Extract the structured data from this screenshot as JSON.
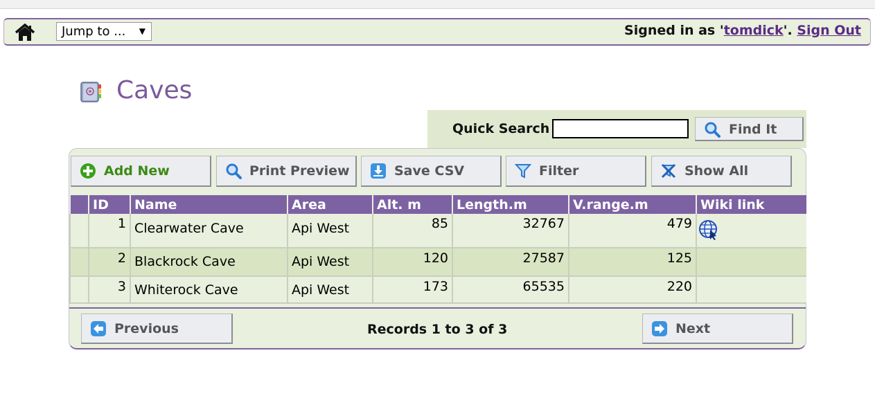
{
  "nav": {
    "jump_label": "Jump to ...",
    "signed_prefix": "Signed in as '",
    "username": "tomdick",
    "signed_mid": "'. ",
    "signout": "Sign Out"
  },
  "page": {
    "title": "Caves"
  },
  "quick_search": {
    "label": "Quick Search",
    "value": "",
    "button": "Find It"
  },
  "toolbar": {
    "add_new": "Add New",
    "print_preview": "Print Preview",
    "save_csv": "Save CSV",
    "filter": "Filter",
    "show_all": "Show All"
  },
  "table": {
    "headers": [
      "",
      "ID",
      "Name",
      "Area",
      "Alt. m",
      "Length.m",
      "V.range.m",
      "Wiki link"
    ],
    "rows": [
      {
        "id": "1",
        "name": "Clearwater Cave",
        "area": "Api West",
        "alt": "85",
        "length": "32767",
        "vrange": "479",
        "wiki": "globe-link-icon"
      },
      {
        "id": "2",
        "name": "Blackrock Cave",
        "area": "Api West",
        "alt": "120",
        "length": "27587",
        "vrange": "125",
        "wiki": ""
      },
      {
        "id": "3",
        "name": "Whiterock Cave",
        "area": "Api West",
        "alt": "173",
        "length": "65535",
        "vrange": "220",
        "wiki": ""
      }
    ]
  },
  "pager": {
    "previous": "Previous",
    "records": "Records 1 to 3 of 3",
    "next": "Next"
  },
  "colors": {
    "header_purple": "#7d62a3",
    "panel_green": "#e9f0de",
    "row_alt": "#d9e4c2",
    "title_purple": "#7b5a9c"
  },
  "icons": {
    "home": "home-icon",
    "add": "plus-circle-icon",
    "print": "magnifier-icon",
    "csv": "download-icon",
    "filter": "funnel-icon",
    "show_all": "clear-filter-icon",
    "prev": "arrow-left-icon",
    "next": "arrow-right-icon"
  }
}
